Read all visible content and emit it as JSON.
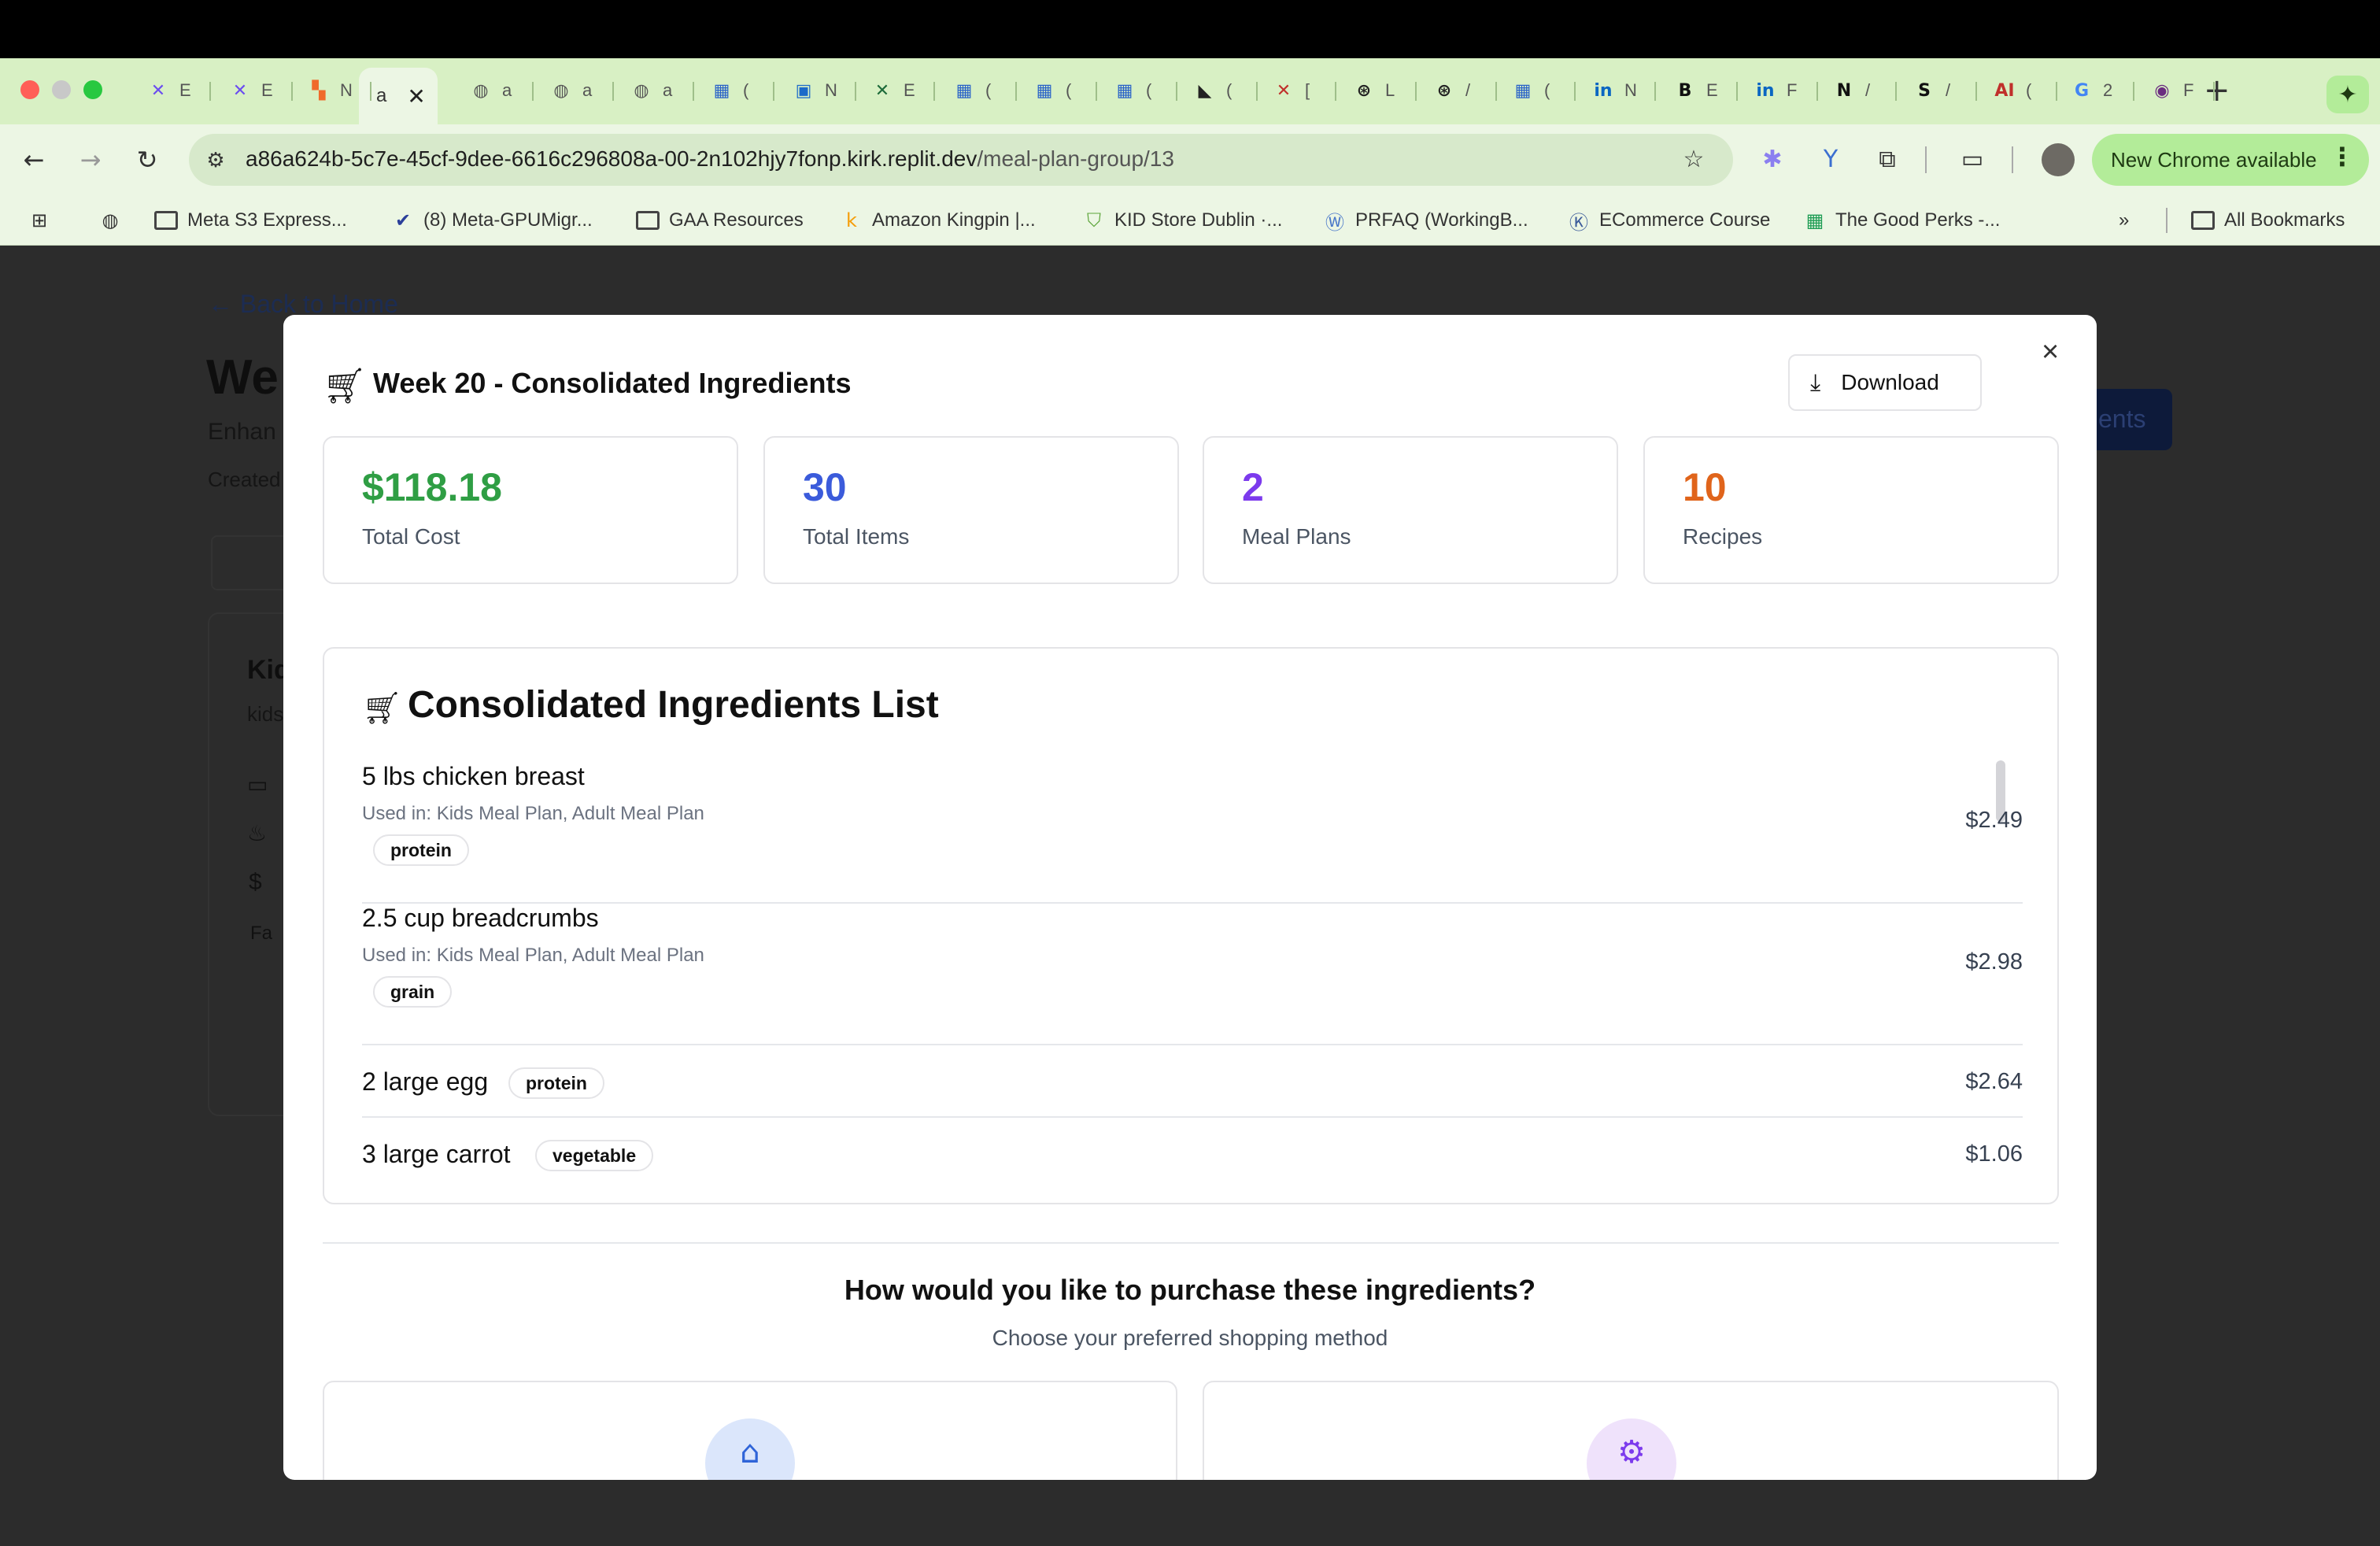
{
  "browser": {
    "tabs": [
      {
        "fav": "✕",
        "title": "E",
        "color": "#6b4df0"
      },
      {
        "fav": "✕",
        "title": "E",
        "color": "#6b4df0"
      },
      {
        "fav": "▚",
        "title": "N",
        "color": "#f06a2a"
      },
      {
        "fav": "◍",
        "title": "a",
        "color": "#555555"
      },
      {
        "fav": "◍",
        "title": "a",
        "color": "#555555"
      },
      {
        "fav": "◍",
        "title": "a",
        "color": "#555555"
      },
      {
        "fav": "▦",
        "title": "(",
        "color": "#2a63c8"
      },
      {
        "fav": "▣",
        "title": "N",
        "color": "#1b6ac9"
      },
      {
        "fav": "✕",
        "title": "E",
        "color": "#1d6b3a"
      },
      {
        "fav": "▦",
        "title": "(",
        "color": "#2a63c8"
      },
      {
        "fav": "▦",
        "title": "(",
        "color": "#2a63c8"
      },
      {
        "fav": "▦",
        "title": "(",
        "color": "#2a63c8"
      },
      {
        "fav": "◣",
        "title": "(",
        "color": "#222222"
      },
      {
        "fav": "✕",
        "title": "[",
        "color": "#c0302b"
      },
      {
        "fav": "⊛",
        "title": "L",
        "color": "#222222"
      },
      {
        "fav": "⊛",
        "title": "/",
        "color": "#222222"
      },
      {
        "fav": "▦",
        "title": "(",
        "color": "#2a63c8"
      },
      {
        "fav": "in",
        "title": "N",
        "color": "#0a66c2"
      },
      {
        "fav": "B",
        "title": "E",
        "color": "#111111"
      },
      {
        "fav": "in",
        "title": "F",
        "color": "#0a66c2"
      },
      {
        "fav": "N",
        "title": "/",
        "color": "#111111"
      },
      {
        "fav": "S",
        "title": "/",
        "color": "#111111"
      },
      {
        "fav": "AI",
        "title": "(",
        "color": "#c0302b"
      },
      {
        "fav": "G",
        "title": "2",
        "color": "#4285f4"
      },
      {
        "fav": "◉",
        "title": "F",
        "color": "#6b2d80"
      }
    ],
    "active_tab": {
      "title": "a",
      "close": "✕"
    },
    "new_tab": "+",
    "gemini_icon": "✦",
    "url_host": "a86a624b-5c7e-45cf-9dee-6616c296808a-00-2n102hjy7fonp.kirk.replit.dev",
    "url_path": "/meal-plan-group/13",
    "update_label": "New Chrome available",
    "bookmarks": [
      {
        "label": "Meta S3 Express...",
        "icon": "folder"
      },
      {
        "label": "(8) Meta-GPUMigr...",
        "icon": "check"
      },
      {
        "label": "GAA Resources",
        "icon": "folder"
      },
      {
        "label": "Amazon Kingpin |...",
        "icon": "k"
      },
      {
        "label": "KID Store Dublin ·...",
        "icon": "shop"
      },
      {
        "label": "PRFAQ (WorkingB...",
        "icon": "w"
      },
      {
        "label": "ECommerce Course",
        "icon": "K"
      },
      {
        "label": "The Good Perks -...",
        "icon": "sheet"
      }
    ],
    "all_bookmarks": "All Bookmarks",
    "overflow": "»"
  },
  "page_bg": {
    "back_link": "← Back to Home",
    "title_fragment": "We",
    "subtitle_fragment": "Enhan",
    "created_fragment": "Created",
    "card_title_fragment": "Kid",
    "card_sub_fragment": "kids",
    "tag_fragment": "Fa",
    "button_fragment": "ents"
  },
  "modal": {
    "title": "Week 20 - Consolidated Ingredients",
    "download_label": "Download",
    "close": "×",
    "stats": [
      {
        "value": "$118.18",
        "label": "Total Cost",
        "color": "#2f9e44"
      },
      {
        "value": "30",
        "label": "Total Items",
        "color": "#3b5bdb"
      },
      {
        "value": "2",
        "label": "Meal Plans",
        "color": "#7c3aed"
      },
      {
        "value": "10",
        "label": "Recipes",
        "color": "#e0641b"
      }
    ],
    "list_title": "Consolidated Ingredients List",
    "ingredients": [
      {
        "name": "5 lbs chicken breast",
        "used": "Used in: Kids Meal Plan, Adult Meal Plan",
        "tag": "protein",
        "price": "$2.49"
      },
      {
        "name": "2.5 cup breadcrumbs",
        "used": "Used in: Kids Meal Plan, Adult Meal Plan",
        "tag": "grain",
        "price": "$2.98"
      },
      {
        "name": "2 large egg",
        "tag": "protein",
        "price": "$2.64"
      },
      {
        "name": "3 large carrot",
        "tag": "vegetable",
        "price": "$1.06"
      }
    ],
    "purchase_heading": "How would you like to purchase these ingredients?",
    "purchase_sub": "Choose your preferred shopping method"
  }
}
